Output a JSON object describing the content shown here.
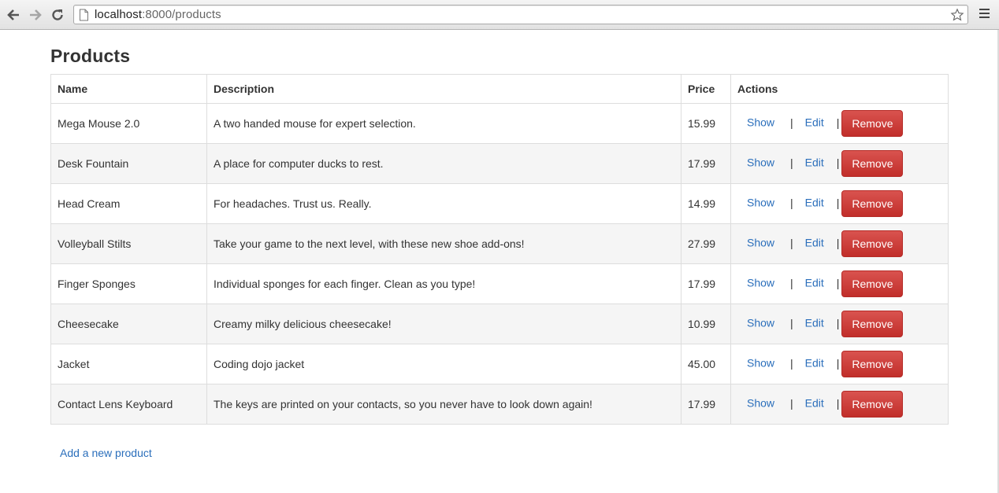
{
  "browser": {
    "url_host": "localhost",
    "url_path": ":8000/products"
  },
  "page": {
    "title": "Products",
    "add_link": "Add a new product"
  },
  "table": {
    "headers": [
      "Name",
      "Description",
      "Price",
      "Actions"
    ],
    "actions": {
      "show": "Show",
      "edit": "Edit",
      "remove": "Remove",
      "separator": "|"
    },
    "rows": [
      {
        "name": "Mega Mouse 2.0",
        "description": "A two handed mouse for expert selection.",
        "price": "15.99"
      },
      {
        "name": "Desk Fountain",
        "description": "A place for computer ducks to rest.",
        "price": "17.99"
      },
      {
        "name": "Head Cream",
        "description": "For headaches. Trust us. Really.",
        "price": "14.99"
      },
      {
        "name": "Volleyball Stilts",
        "description": "Take your game to the next level, with these new shoe add-ons!",
        "price": "27.99"
      },
      {
        "name": "Finger Sponges",
        "description": "Individual sponges for each finger. Clean as you type!",
        "price": "17.99"
      },
      {
        "name": "Cheesecake",
        "description": "Creamy milky delicious cheesecake!",
        "price": "10.99"
      },
      {
        "name": "Jacket",
        "description": "Coding dojo jacket",
        "price": "45.00"
      },
      {
        "name": "Contact Lens Keyboard",
        "description": "The keys are printed on your contacts, so you never have to look down again!",
        "price": "17.99"
      }
    ]
  },
  "colors": {
    "link": "#2a6ebb",
    "danger": "#d9534f",
    "stripe": "#f5f5f5"
  }
}
